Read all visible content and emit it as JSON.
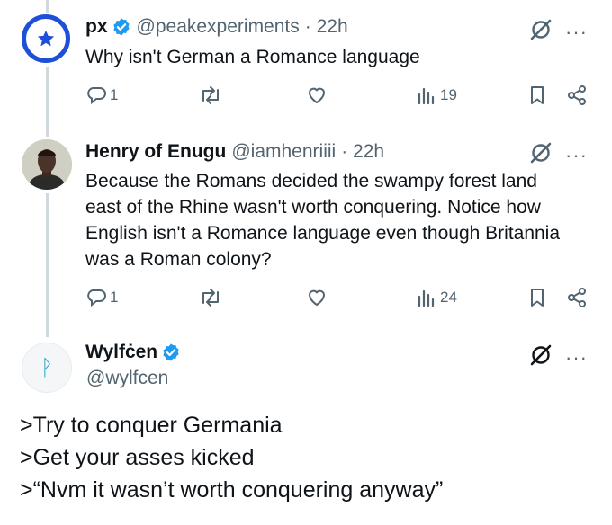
{
  "tweet1": {
    "name": "px",
    "handle": "@peakexperiments",
    "time": "· 22h",
    "text": "Why isn't German a Romance language",
    "replies": "1",
    "views": "19"
  },
  "tweet2": {
    "name": "Henry of Enugu",
    "handle": "@iamhenriiii",
    "time": "· 22h",
    "lines": [
      "Because the Romans decided the swampy forest land",
      "east of the Rhine wasn't worth conquering. Notice how",
      "English isn't a Romance language even though Britannia",
      "was a Roman colony?"
    ],
    "replies": "1",
    "views": "24"
  },
  "tweet3": {
    "name": "Wylfċen",
    "handle": "@wylfcen",
    "avatar_glyph": "ᚹ",
    "lines": [
      ">Try to conquer Germania",
      ">Get your asses kicked",
      ">“Nvm it wasn’t worth conquering anyway”"
    ]
  },
  "more_label": "···",
  "colors": {
    "verified": "#1d9bf0",
    "muted": "#536471",
    "line": "#cfd9de",
    "px_ring": "#1d4fd8"
  }
}
